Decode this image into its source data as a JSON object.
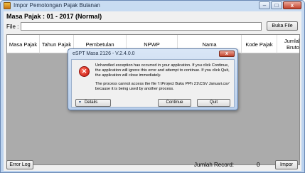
{
  "window": {
    "title": "Impor Pemotongan Pajak Bulanan",
    "controls": {
      "minimize": "–",
      "maximize": "□",
      "close": "x"
    }
  },
  "main": {
    "masa_pajak": "Masa Pajak :  01 - 2017 (Normal)",
    "file_label": "File :",
    "file_value": "",
    "buka_file_label": "Buka File",
    "columns": [
      {
        "label": "Masa Pajak"
      },
      {
        "label": "Tahun Pajak"
      },
      {
        "label": "Pembetulan"
      },
      {
        "label": "NPWP"
      },
      {
        "label": "Nama"
      },
      {
        "label": "Kode Pajak"
      },
      {
        "label": "Jumlah Bruto"
      }
    ]
  },
  "footer": {
    "error_log_label": "Error Log",
    "jumlah_record_label": "Jumlah Record:",
    "jumlah_record_value": "0",
    "impor_label": "Impor"
  },
  "dialog": {
    "title": "eSPT Masa 2126 - V.2.4.0.0",
    "close_glyph": "x",
    "error_glyph": "✕",
    "message1": "Unhandled exception has occurred in your application. If you click Continue, the application will ignore this error and attempt to continue. If you click Quit, the application will close immediately.",
    "message2": "The process cannot access the file 'I:\\Project Buku PPh 21\\CSV Januari.csv' because it is being used by another process.",
    "details_label": "Details",
    "continue_label": "Continue",
    "quit_label": "Quit"
  },
  "icons": {
    "app": "app-icon",
    "error": "error-icon",
    "details_chevron": "chevron-down-icon"
  },
  "colors": {
    "titlebar": "#c9dcf2",
    "client": "#f0f0f0",
    "grid_background": "#ababab",
    "error_red": "#c3130b",
    "close_red": "#c2422c"
  }
}
